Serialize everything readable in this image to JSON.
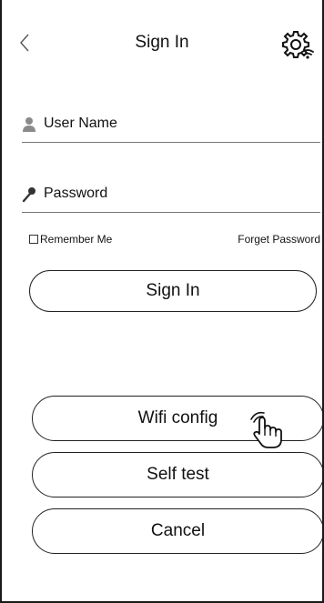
{
  "header": {
    "title": "Sign In",
    "back_icon": "chevron-left-icon",
    "settings_icon": "gear-wifi-icon"
  },
  "form": {
    "username": {
      "label": "User Name",
      "icon": "user-icon"
    },
    "password": {
      "label": "Password",
      "icon": "key-icon"
    },
    "remember_label": "Remember Me",
    "remember_checked": false,
    "forget_label": "Forget Password",
    "signin_label": "Sign In"
  },
  "actions": {
    "wifi_label": "Wifi config",
    "selftest_label": "Self test",
    "cancel_label": "Cancel"
  },
  "cursor": {
    "icon": "hand-pointer-icon"
  },
  "colors": {
    "border": "#1a1a1a",
    "icon": "#8a8a8a",
    "text": "#111111",
    "background": "#ffffff"
  }
}
